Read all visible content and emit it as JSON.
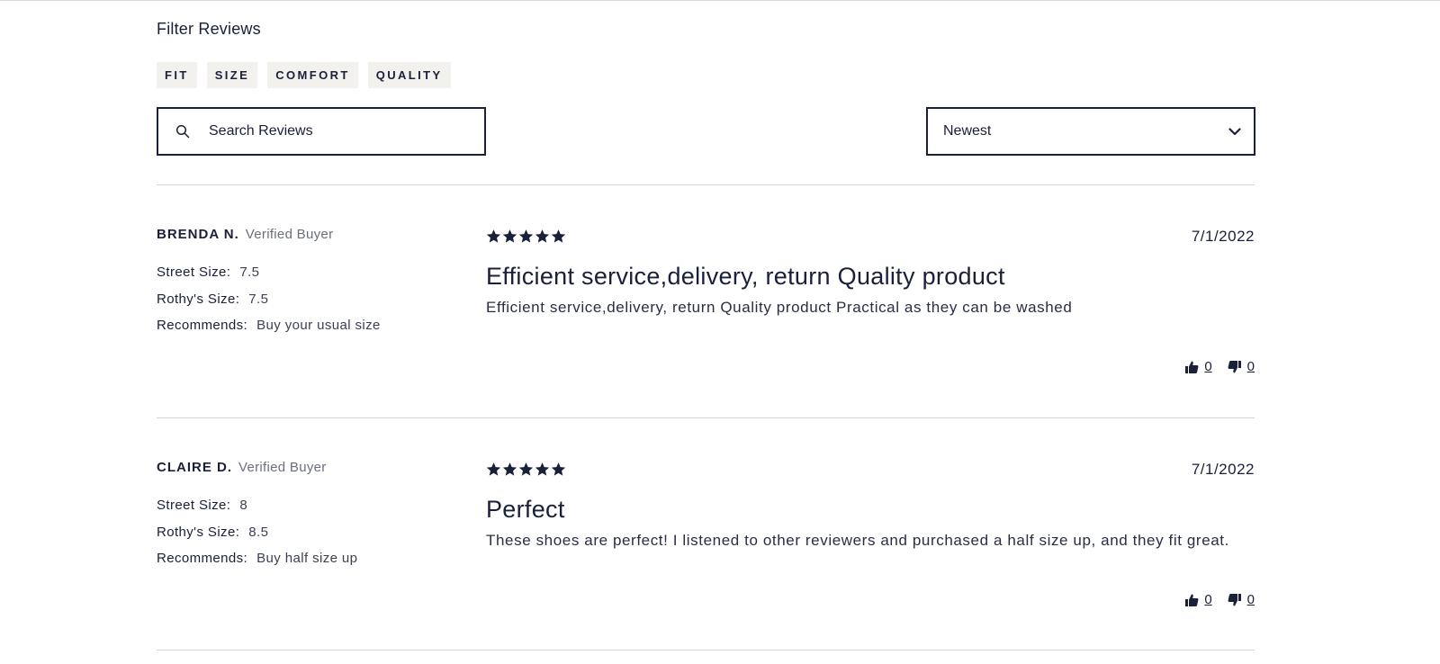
{
  "filter": {
    "title": "Filter Reviews",
    "chips": [
      "FIT",
      "SIZE",
      "COMFORT",
      "QUALITY"
    ]
  },
  "search": {
    "placeholder": "Search Reviews",
    "icon": "search-icon"
  },
  "sort": {
    "selected": "Newest",
    "icon": "chevron-down-icon"
  },
  "reviews": [
    {
      "name": "BRENDA N.",
      "badge": "Verified Buyer",
      "street_size_label": "Street Size:",
      "street_size": "7.5",
      "rothys_size_label": "Rothy's Size:",
      "rothys_size": "7.5",
      "recommends_label": "Recommends:",
      "recommends": "Buy your usual size",
      "rating": 5,
      "date": "7/1/2022",
      "headline": "Efficient service,delivery, return Quality product",
      "body": "Efficient service,delivery, return Quality product Practical as they can be washed",
      "helpful_yes": "0",
      "helpful_no": "0"
    },
    {
      "name": "CLAIRE D.",
      "badge": "Verified Buyer",
      "street_size_label": "Street Size:",
      "street_size": "8",
      "rothys_size_label": "Rothy's Size:",
      "rothys_size": "8.5",
      "recommends_label": "Recommends:",
      "recommends": "Buy half size up",
      "rating": 5,
      "date": "7/1/2022",
      "headline": "Perfect",
      "body": "These shoes are perfect! I listened to other reviewers and purchased a half size up, and they fit great.",
      "helpful_yes": "0",
      "helpful_no": "0"
    }
  ],
  "colors": {
    "ink": "#1a1f3a",
    "chip_bg": "#f2f1ee",
    "rule": "#d3d3d3"
  }
}
